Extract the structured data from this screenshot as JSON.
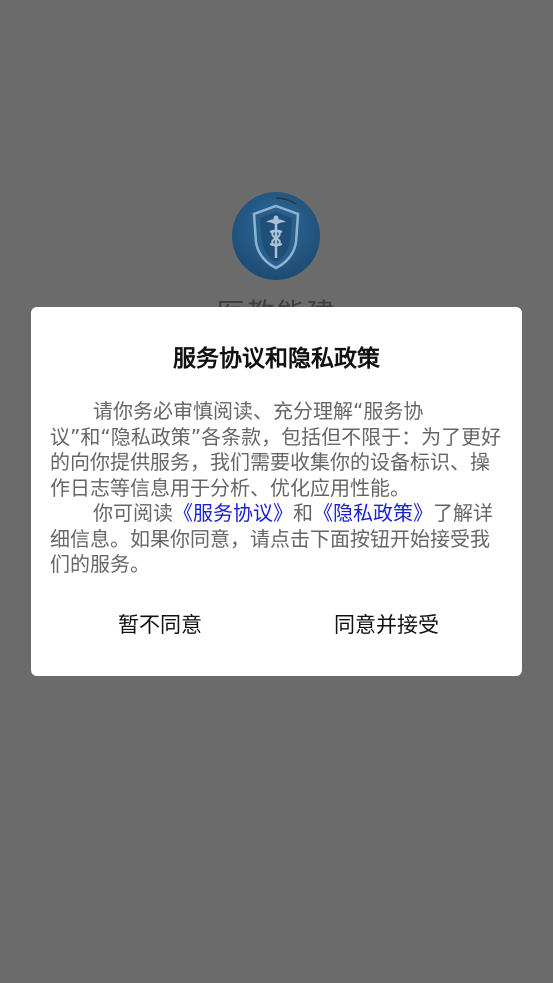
{
  "background": {
    "app_name": "医教能建",
    "logo_icon": "shield-caduceus-icon",
    "overlay_color": "#6b6b6b"
  },
  "dialog": {
    "title": "服务协议和隐私政策",
    "paragraph1": "请你务必审慎阅读、充分理解“服务协议”和“隐私政策”各条款，包括但不限于：为了更好的向你提供服务，我们需要收集你的设备标识、操作日志等信息用于分析、优化应用性能。",
    "paragraph2_prefix": "你可阅读",
    "service_link": "《服务协议》",
    "paragraph2_and": "和",
    "privacy_link": "《隐私政策》",
    "paragraph2_suffix": "了解详细信息。如果你同意，请点击下面按钮开始接受我们的服务。",
    "decline_label": "暂不同意",
    "accept_label": "同意并接受",
    "link_color": "#1a1fd6"
  }
}
